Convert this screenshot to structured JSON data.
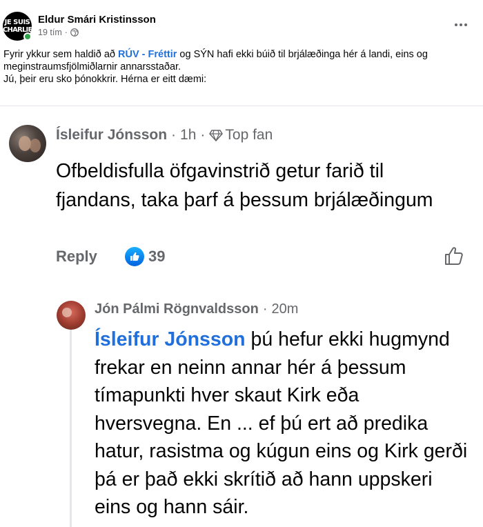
{
  "post": {
    "author": "Eldur Smári Kristinsson",
    "time": "19 tím",
    "avatar_text_line1": "JE SUIS",
    "avatar_text_line2": "CHARLIE",
    "text_before_link": "Fyrir ykkur sem haldið að ",
    "link_text": "RÚV - Fréttir",
    "text_after_link": " og SÝN hafi ekki búið til brjálæðinga hér á landi, eins og meginstraumsfjölmiðlarnir annarsstaðar.",
    "text_line2": "Jú, þeir eru sko þónokkrir. Hérna er eitt dæmi:"
  },
  "comment1": {
    "author": "Ísleifur Jónsson",
    "separator": "·",
    "time": "1h",
    "badge": "Top fan",
    "body": "Ofbeldisfulla öfgavinstrið getur farið til fjandans, taka þarf á þessum brjálæðingum",
    "reply_label": "Reply",
    "like_count": "39"
  },
  "comment2": {
    "author": "Jón Pálmi Rögnvaldsson",
    "separator": "·",
    "time": "20m",
    "mention": "Ísleifur Jónsson",
    "body": " þú hefur ekki hugmynd frekar en neinn annar hér á þessum tímapunkti hver skaut Kirk eða hversvegna. En ... ef þú ert að predika hatur, rasistma og kúgun eins og Kirk gerði þá er það ekki skrítið að hann uppskeri eins og hann sáir."
  },
  "colors": {
    "link_blue": "#216fdb",
    "like_blue": "#0062df",
    "online_green": "#31a24c",
    "meta_gray": "#65676b"
  },
  "icons": [
    "globe-icon",
    "more-icon",
    "diamond-icon",
    "like-icon",
    "thumb-outline-icon"
  ]
}
